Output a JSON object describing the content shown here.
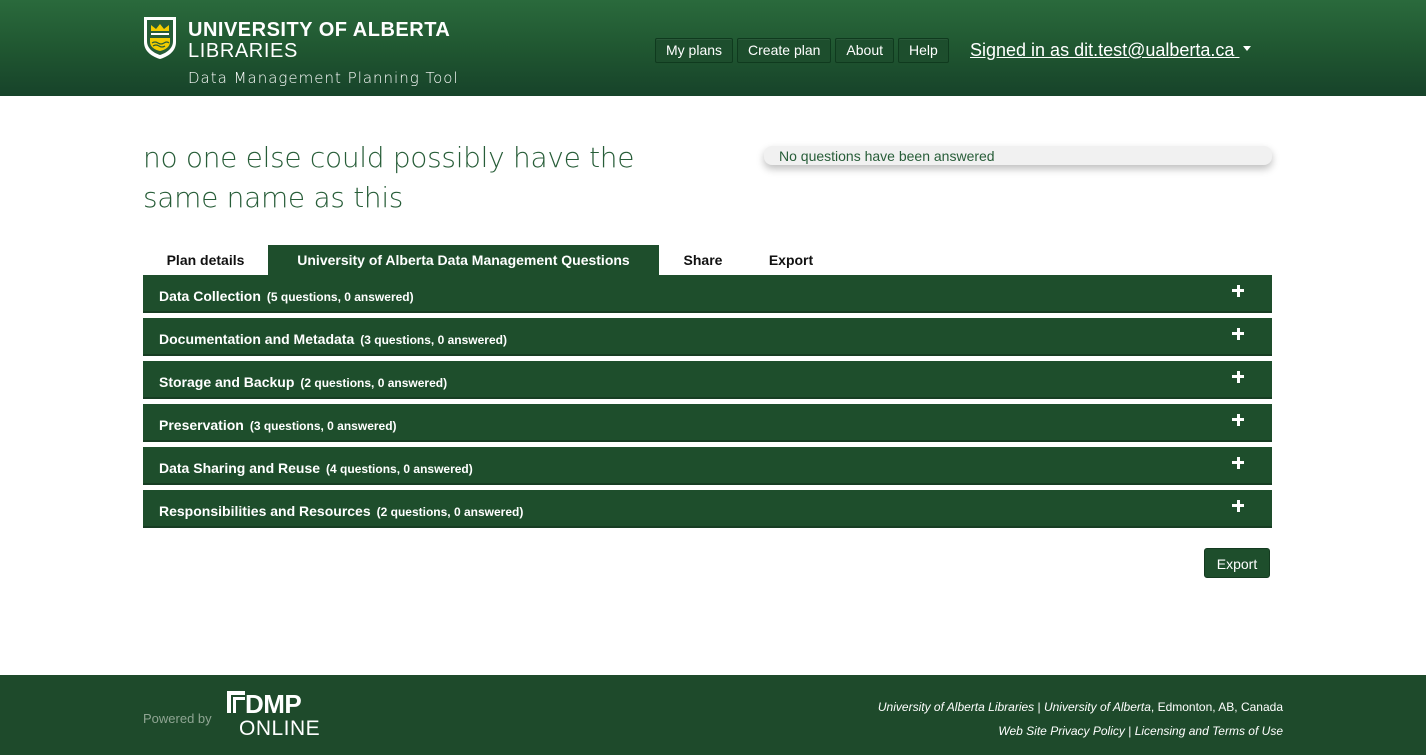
{
  "header": {
    "university": "UNIVERSITY OF ALBERTA",
    "libraries": "LIBRARIES",
    "tool_name": "Data Management Planning Tool",
    "nav": [
      "My plans",
      "Create plan",
      "About",
      "Help"
    ],
    "signed_in": "Signed in as dit.test@ualberta.ca"
  },
  "plan": {
    "title": "no one else could possibly have the same name as this",
    "status": "No questions have been answered"
  },
  "tabs": [
    "Plan details",
    "University of Alberta Data Management Questions",
    "Share",
    "Export"
  ],
  "active_tab": "University of Alberta Data Management Questions",
  "sections": [
    {
      "title": "Data Collection",
      "meta": "(5 questions, 0 answered)"
    },
    {
      "title": "Documentation and Metadata",
      "meta": "(3 questions, 0 answered)"
    },
    {
      "title": "Storage and Backup",
      "meta": "(2 questions, 0 answered)"
    },
    {
      "title": "Preservation",
      "meta": "(3 questions, 0 answered)"
    },
    {
      "title": "Data Sharing and Reuse",
      "meta": "(4 questions, 0 answered)"
    },
    {
      "title": "Responsibilities and Resources",
      "meta": "(2 questions, 0 answered)"
    }
  ],
  "export_button": "Export",
  "footer": {
    "powered_by": "Powered by",
    "dmp": "DMP",
    "online": "ONLINE",
    "line1_a": "University of Alberta Libraries",
    "line1_sep": " | ",
    "line1_b": "University of Alberta",
    "line1_c": ", Edmonton, AB, Canada",
    "line2_a": "Web Site Privacy Policy",
    "line2_sep": " | ",
    "line2_b": "Licensing and Terms of Use"
  },
  "colors": {
    "brand_green": "#275D38",
    "header_green": "#1f5530",
    "section_green": "#1e4e2c",
    "accent_gold": "#F2CD00"
  }
}
